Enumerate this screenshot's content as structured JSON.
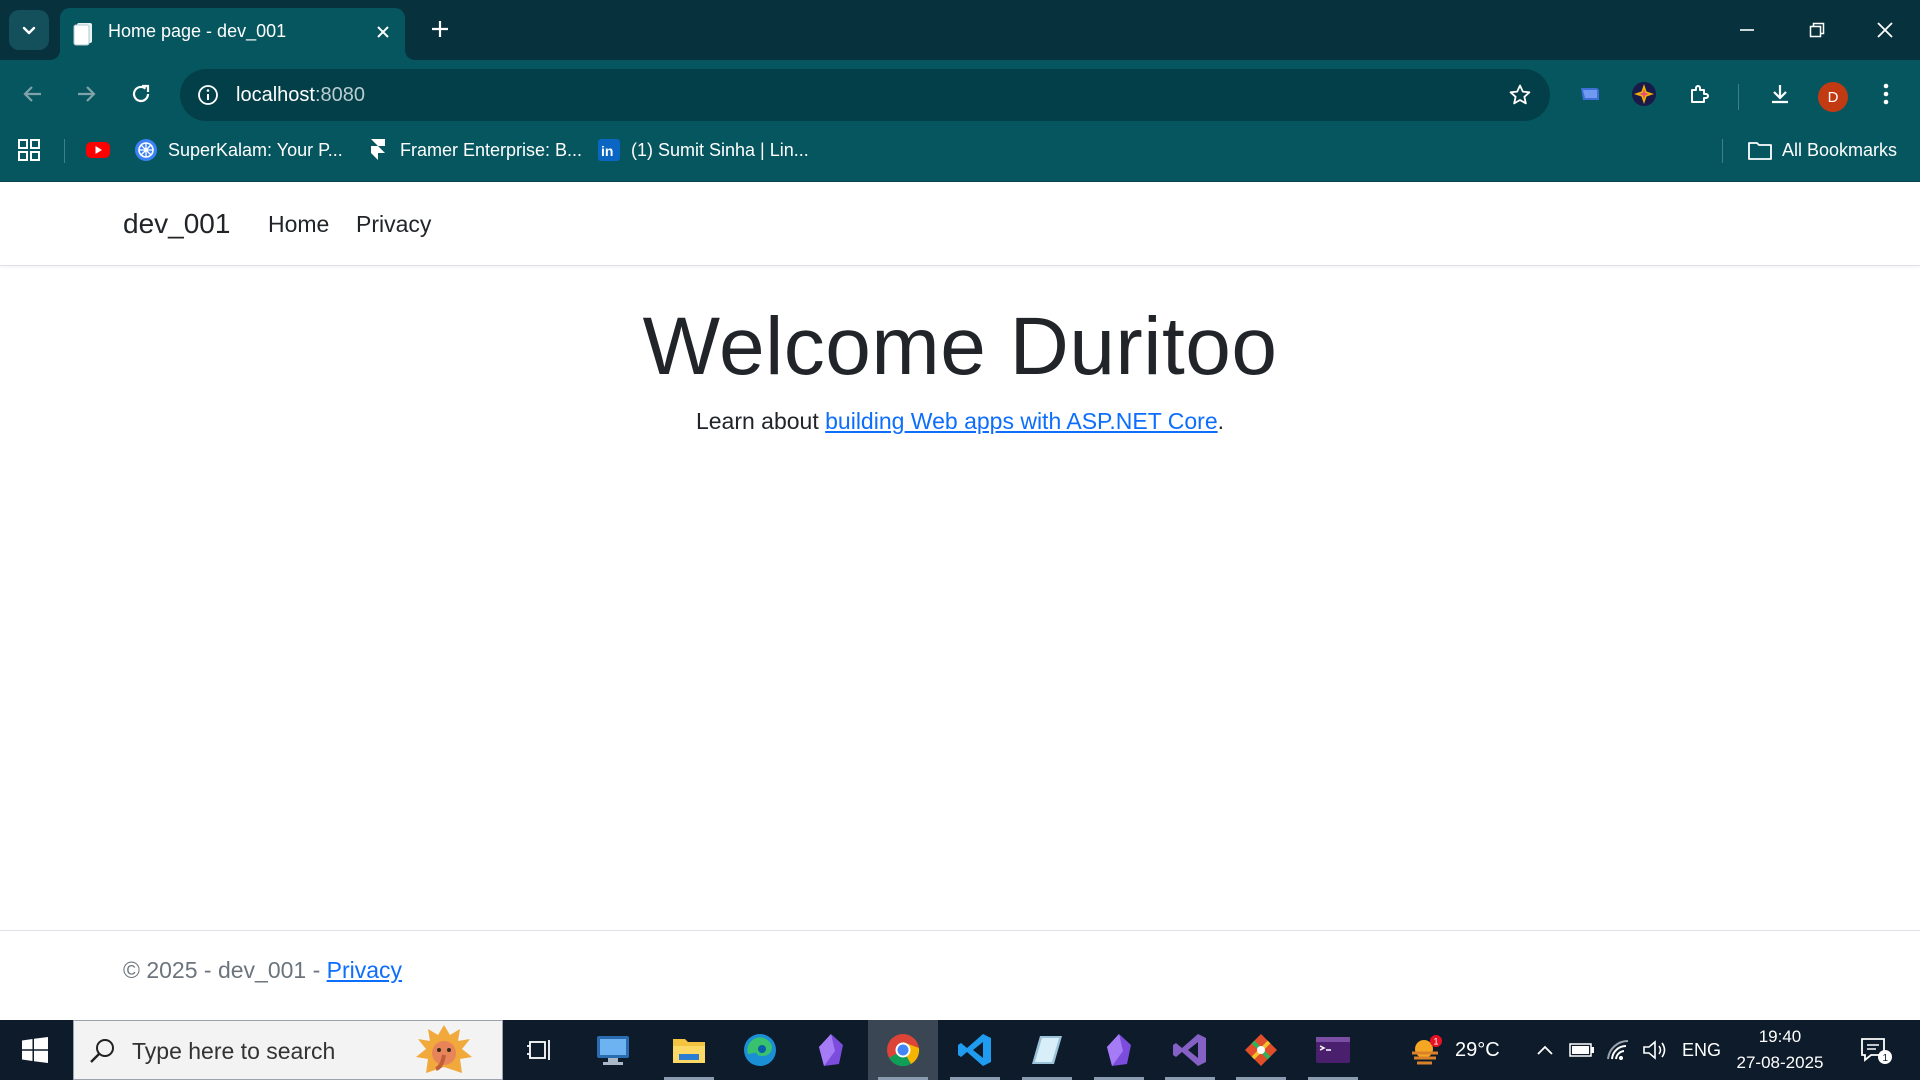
{
  "browser": {
    "tab_title": "Home page - dev_001",
    "url_host": "localhost",
    "url_port": ":8080",
    "profile_initial": "D",
    "bookmarks": [
      {
        "label": "",
        "icon": "youtube-icon"
      },
      {
        "label": "SuperKalam: Your P...",
        "icon": "superkalam-icon"
      },
      {
        "label": "Framer Enterprise: B...",
        "icon": "framer-icon"
      },
      {
        "label": "(1) Sumit Sinha | Lin...",
        "icon": "linkedin-icon"
      }
    ],
    "all_bookmarks_label": "All Bookmarks"
  },
  "site": {
    "brand": "dev_001",
    "nav": [
      "Home",
      "Privacy"
    ],
    "heading": "Welcome Duritoo",
    "learn_prefix": "Learn about ",
    "learn_link": "building Web apps with ASP.NET Core",
    "learn_suffix": ".",
    "footer_prefix": "© 2025 - dev_001 - ",
    "footer_link": "Privacy"
  },
  "taskbar": {
    "search_placeholder": "Type here to search",
    "weather_temp": "29°C",
    "weather_badge": "1",
    "language": "ENG",
    "time": "19:40",
    "date": "27-08-2025",
    "notification_count": "1"
  },
  "colors": {
    "tab_strip": "#07323d",
    "toolbar": "#06565f",
    "link": "#0d6efd",
    "taskbar": "#0d1b2a"
  }
}
